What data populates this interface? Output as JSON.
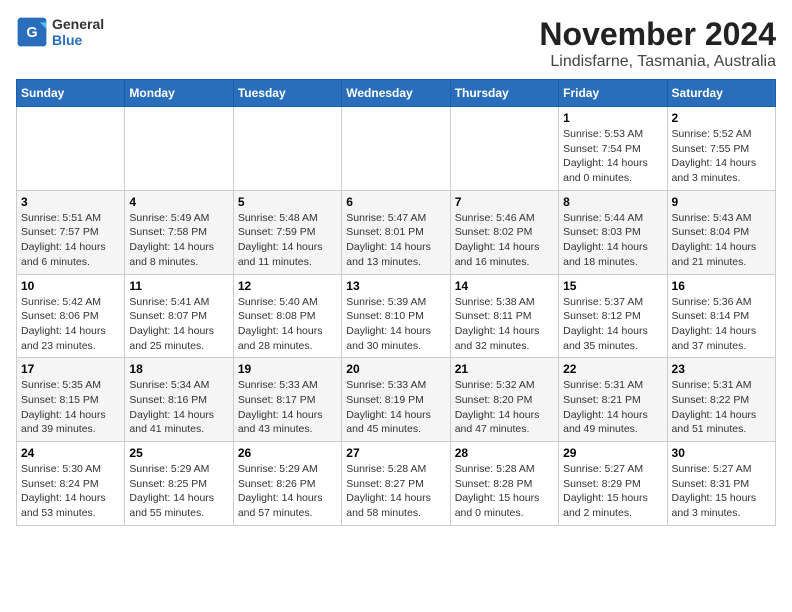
{
  "app": {
    "logo_general": "General",
    "logo_blue": "Blue",
    "title": "November 2024",
    "subtitle": "Lindisfarne, Tasmania, Australia"
  },
  "calendar": {
    "headers": [
      "Sunday",
      "Monday",
      "Tuesday",
      "Wednesday",
      "Thursday",
      "Friday",
      "Saturday"
    ],
    "weeks": [
      [
        {
          "day": "",
          "info": ""
        },
        {
          "day": "",
          "info": ""
        },
        {
          "day": "",
          "info": ""
        },
        {
          "day": "",
          "info": ""
        },
        {
          "day": "",
          "info": ""
        },
        {
          "day": "1",
          "info": "Sunrise: 5:53 AM\nSunset: 7:54 PM\nDaylight: 14 hours and 0 minutes."
        },
        {
          "day": "2",
          "info": "Sunrise: 5:52 AM\nSunset: 7:55 PM\nDaylight: 14 hours and 3 minutes."
        }
      ],
      [
        {
          "day": "3",
          "info": "Sunrise: 5:51 AM\nSunset: 7:57 PM\nDaylight: 14 hours and 6 minutes."
        },
        {
          "day": "4",
          "info": "Sunrise: 5:49 AM\nSunset: 7:58 PM\nDaylight: 14 hours and 8 minutes."
        },
        {
          "day": "5",
          "info": "Sunrise: 5:48 AM\nSunset: 7:59 PM\nDaylight: 14 hours and 11 minutes."
        },
        {
          "day": "6",
          "info": "Sunrise: 5:47 AM\nSunset: 8:01 PM\nDaylight: 14 hours and 13 minutes."
        },
        {
          "day": "7",
          "info": "Sunrise: 5:46 AM\nSunset: 8:02 PM\nDaylight: 14 hours and 16 minutes."
        },
        {
          "day": "8",
          "info": "Sunrise: 5:44 AM\nSunset: 8:03 PM\nDaylight: 14 hours and 18 minutes."
        },
        {
          "day": "9",
          "info": "Sunrise: 5:43 AM\nSunset: 8:04 PM\nDaylight: 14 hours and 21 minutes."
        }
      ],
      [
        {
          "day": "10",
          "info": "Sunrise: 5:42 AM\nSunset: 8:06 PM\nDaylight: 14 hours and 23 minutes."
        },
        {
          "day": "11",
          "info": "Sunrise: 5:41 AM\nSunset: 8:07 PM\nDaylight: 14 hours and 25 minutes."
        },
        {
          "day": "12",
          "info": "Sunrise: 5:40 AM\nSunset: 8:08 PM\nDaylight: 14 hours and 28 minutes."
        },
        {
          "day": "13",
          "info": "Sunrise: 5:39 AM\nSunset: 8:10 PM\nDaylight: 14 hours and 30 minutes."
        },
        {
          "day": "14",
          "info": "Sunrise: 5:38 AM\nSunset: 8:11 PM\nDaylight: 14 hours and 32 minutes."
        },
        {
          "day": "15",
          "info": "Sunrise: 5:37 AM\nSunset: 8:12 PM\nDaylight: 14 hours and 35 minutes."
        },
        {
          "day": "16",
          "info": "Sunrise: 5:36 AM\nSunset: 8:14 PM\nDaylight: 14 hours and 37 minutes."
        }
      ],
      [
        {
          "day": "17",
          "info": "Sunrise: 5:35 AM\nSunset: 8:15 PM\nDaylight: 14 hours and 39 minutes."
        },
        {
          "day": "18",
          "info": "Sunrise: 5:34 AM\nSunset: 8:16 PM\nDaylight: 14 hours and 41 minutes."
        },
        {
          "day": "19",
          "info": "Sunrise: 5:33 AM\nSunset: 8:17 PM\nDaylight: 14 hours and 43 minutes."
        },
        {
          "day": "20",
          "info": "Sunrise: 5:33 AM\nSunset: 8:19 PM\nDaylight: 14 hours and 45 minutes."
        },
        {
          "day": "21",
          "info": "Sunrise: 5:32 AM\nSunset: 8:20 PM\nDaylight: 14 hours and 47 minutes."
        },
        {
          "day": "22",
          "info": "Sunrise: 5:31 AM\nSunset: 8:21 PM\nDaylight: 14 hours and 49 minutes."
        },
        {
          "day": "23",
          "info": "Sunrise: 5:31 AM\nSunset: 8:22 PM\nDaylight: 14 hours and 51 minutes."
        }
      ],
      [
        {
          "day": "24",
          "info": "Sunrise: 5:30 AM\nSunset: 8:24 PM\nDaylight: 14 hours and 53 minutes."
        },
        {
          "day": "25",
          "info": "Sunrise: 5:29 AM\nSunset: 8:25 PM\nDaylight: 14 hours and 55 minutes."
        },
        {
          "day": "26",
          "info": "Sunrise: 5:29 AM\nSunset: 8:26 PM\nDaylight: 14 hours and 57 minutes."
        },
        {
          "day": "27",
          "info": "Sunrise: 5:28 AM\nSunset: 8:27 PM\nDaylight: 14 hours and 58 minutes."
        },
        {
          "day": "28",
          "info": "Sunrise: 5:28 AM\nSunset: 8:28 PM\nDaylight: 15 hours and 0 minutes."
        },
        {
          "day": "29",
          "info": "Sunrise: 5:27 AM\nSunset: 8:29 PM\nDaylight: 15 hours and 2 minutes."
        },
        {
          "day": "30",
          "info": "Sunrise: 5:27 AM\nSunset: 8:31 PM\nDaylight: 15 hours and 3 minutes."
        }
      ]
    ]
  }
}
